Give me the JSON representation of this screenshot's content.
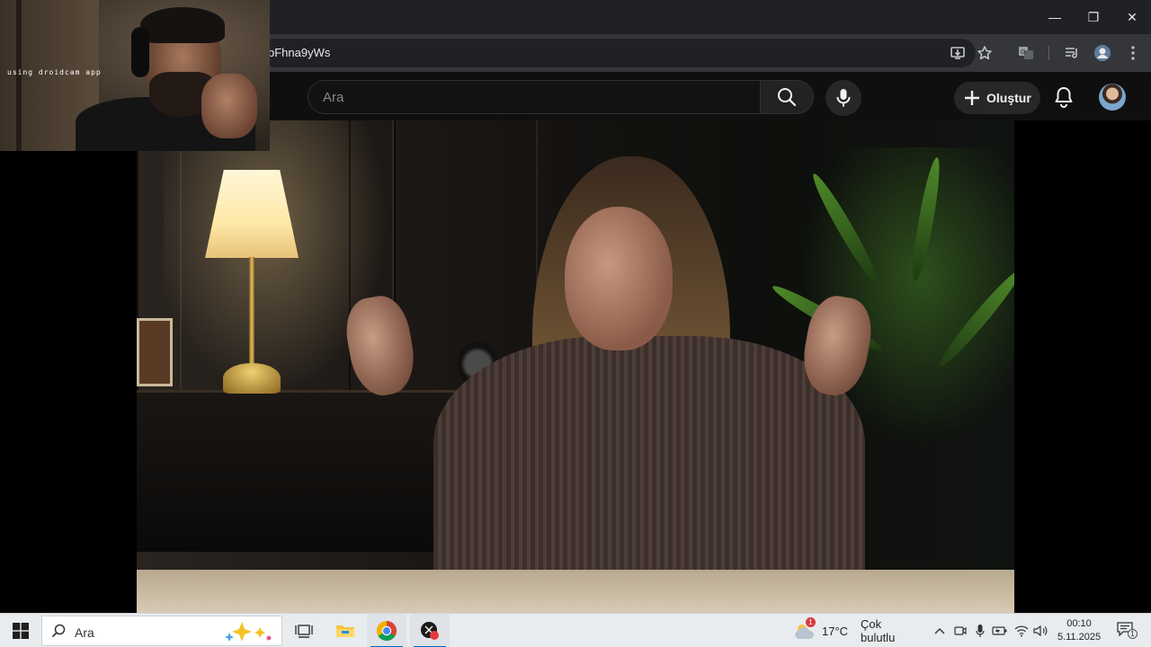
{
  "browser": {
    "url_fragment": "bFhna9yWs",
    "window_controls": {
      "minimize": "—",
      "restore": "❐",
      "close": "✕"
    }
  },
  "youtube": {
    "search_placeholder": "Ara",
    "create_label": "Oluştur"
  },
  "webcam": {
    "overlay_text": "using droidcam app"
  },
  "taskbar": {
    "search_placeholder": "Ara",
    "weather_temp": "17°C",
    "weather_desc": "Çok bulutlu",
    "weather_badge": "1",
    "time": "00:10",
    "date": "5.11.2025",
    "notification_count": "1"
  },
  "colors": {
    "chrome_titlebar": "#202124",
    "chrome_toolbar": "#35363a",
    "youtube_bg": "#0f0f0f",
    "taskbar_bg": "#e9ecef",
    "windows_accent": "#0067c0"
  },
  "icons": [
    "minimize-icon",
    "restore-icon",
    "close-icon",
    "install-app-icon",
    "bookmark-star-icon",
    "translate-icon",
    "media-control-icon",
    "profile-icon",
    "kebab-menu-icon",
    "search-icon",
    "mic-icon",
    "plus-icon",
    "bell-icon",
    "windows-start-icon",
    "task-view-icon",
    "file-explorer-icon",
    "chrome-icon",
    "recorder-icon",
    "weather-icon",
    "chevron-up-icon",
    "camera-icon",
    "microphone-tray-icon",
    "battery-icon",
    "wifi-icon",
    "volume-icon",
    "notification-icon"
  ]
}
